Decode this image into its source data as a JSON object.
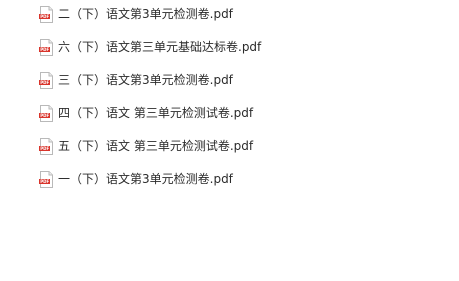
{
  "files": [
    {
      "name": "二（下）语文第3单元检测卷.pdf",
      "icon": "pdf-file-icon"
    },
    {
      "name": "六（下）语文第三单元基础达标卷.pdf",
      "icon": "pdf-file-icon"
    },
    {
      "name": "三（下）语文第3单元检测卷.pdf",
      "icon": "pdf-file-icon"
    },
    {
      "name": "四（下）语文 第三单元检测试卷.pdf",
      "icon": "pdf-file-icon"
    },
    {
      "name": "五（下）语文 第三单元检测试卷.pdf",
      "icon": "pdf-file-icon"
    },
    {
      "name": "一（下）语文第3单元检测卷.pdf",
      "icon": "pdf-file-icon"
    }
  ],
  "colors": {
    "pdf_accent": "#d9342b",
    "text": "#2b2b2b",
    "background": "#ffffff"
  }
}
